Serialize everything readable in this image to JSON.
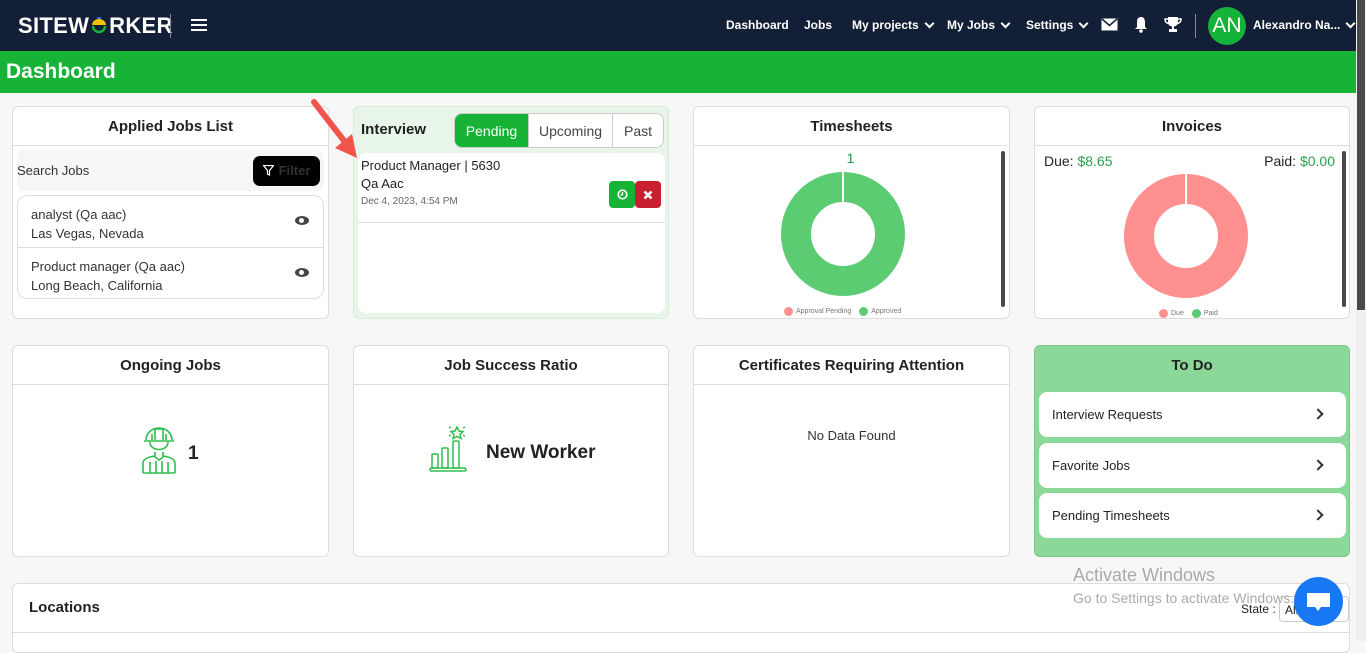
{
  "header": {
    "logo": "SITEWORKER",
    "nav": [
      {
        "label": "Dashboard",
        "dropdown": false
      },
      {
        "label": "Jobs",
        "dropdown": false
      },
      {
        "label": "My projects",
        "dropdown": true
      },
      {
        "label": "My Jobs",
        "dropdown": true
      },
      {
        "label": "Settings",
        "dropdown": true
      }
    ],
    "icons": [
      "mail-icon",
      "bell-icon",
      "trophy-icon"
    ],
    "user": {
      "initials": "AN",
      "name": "Alexandro Na..."
    }
  },
  "page_title": "Dashboard",
  "applied_jobs": {
    "title": "Applied Jobs List",
    "search_label": "Search Jobs",
    "filter_label": "Filter",
    "items": [
      {
        "title": "analyst (Qa aac)",
        "location": "Las Vegas, Nevada"
      },
      {
        "title": "Product manager (Qa aac)",
        "location": "Long Beach, California"
      }
    ]
  },
  "interview": {
    "title": "Interview",
    "tabs": [
      "Pending",
      "Upcoming",
      "Past"
    ],
    "active_tab": "Pending",
    "items": [
      {
        "title": "Product Manager | 5630",
        "company": "Qa Aac",
        "datetime": "Dec 4, 2023, 4:54 PM"
      }
    ]
  },
  "timesheets": {
    "title": "Timesheets",
    "count": "1",
    "legend": [
      "Approval Pending",
      "Approved"
    ]
  },
  "invoices": {
    "title": "Invoices",
    "due_label": "Due:",
    "due_value": "$8.65",
    "paid_label": "Paid:",
    "paid_value": "$0.00",
    "legend": [
      "Due",
      "Paid"
    ]
  },
  "ongoing_jobs": {
    "title": "Ongoing Jobs",
    "count": "1"
  },
  "job_success": {
    "title": "Job Success Ratio",
    "value": "New Worker"
  },
  "certificates": {
    "title": "Certificates Requiring Attention",
    "empty": "No Data Found"
  },
  "todo": {
    "title": "To Do",
    "items": [
      "Interview Requests",
      "Favorite Jobs",
      "Pending Timesheets"
    ]
  },
  "locations": {
    "title": "Locations",
    "state_label": "State :",
    "state_value": "All"
  },
  "watermark": {
    "line1": "Activate Windows",
    "line2": "Go to Settings to activate Windows."
  },
  "colors": {
    "brand_green": "#17b336",
    "navy": "#131f37",
    "due_red": "#ff9090",
    "approved_green": "#5ccc73",
    "danger": "#c8202f"
  },
  "chart_data": [
    {
      "type": "pie",
      "title": "Timesheets",
      "categories": [
        "Approval Pending",
        "Approved"
      ],
      "values": [
        0,
        1
      ],
      "colors": [
        "#ff9090",
        "#5ccc73"
      ]
    },
    {
      "type": "pie",
      "title": "Invoices",
      "categories": [
        "Due",
        "Paid"
      ],
      "values": [
        8.65,
        0.0
      ],
      "colors": [
        "#ff9090",
        "#5ccc73"
      ]
    }
  ]
}
